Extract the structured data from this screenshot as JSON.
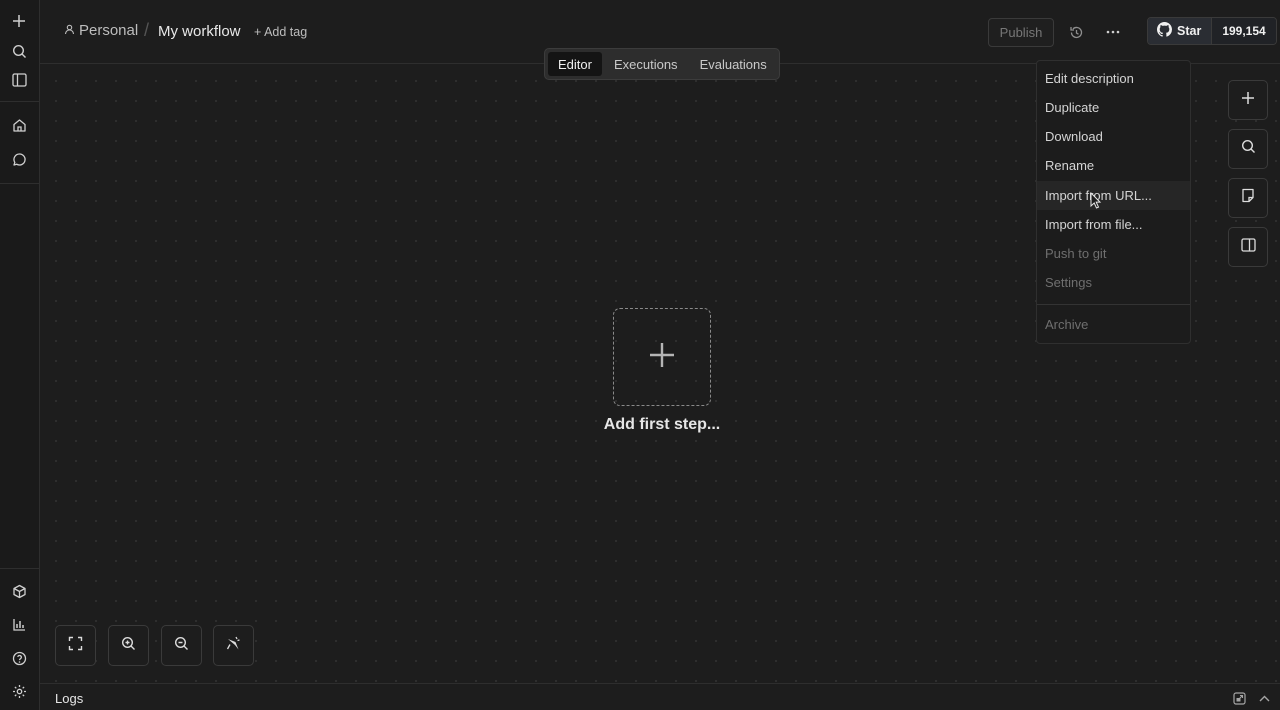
{
  "breadcrumb": {
    "owner": "Personal",
    "separator": "/",
    "title": "My workflow",
    "add_tag": "+ Add tag"
  },
  "header": {
    "publish": "Publish",
    "history_icon": "history-icon",
    "more_icon": "more-horizontal-icon"
  },
  "github": {
    "star_label": "Star",
    "count": "199,154"
  },
  "tabs": [
    {
      "label": "Editor",
      "active": true
    },
    {
      "label": "Executions",
      "active": false
    },
    {
      "label": "Evaluations",
      "active": false
    }
  ],
  "canvas": {
    "add_first_step": "Add first step..."
  },
  "menu": {
    "items": [
      {
        "label": "Edit description",
        "disabled": false
      },
      {
        "label": "Duplicate",
        "disabled": false
      },
      {
        "label": "Download",
        "disabled": false
      },
      {
        "label": "Rename",
        "disabled": false
      },
      {
        "label": "Import from URL...",
        "disabled": false,
        "hovered": true
      },
      {
        "label": "Import from file...",
        "disabled": false
      },
      {
        "label": "Push to git",
        "disabled": true
      },
      {
        "label": "Settings",
        "disabled": true
      },
      {
        "label": "Archive",
        "disabled": true
      }
    ]
  },
  "logs": {
    "label": "Logs"
  },
  "colors": {
    "background": "#1d1d1d",
    "panel": "#2d2d2d",
    "border": "#3a3a3a",
    "text": "#e6e6e6",
    "muted": "#6f6f6f"
  }
}
